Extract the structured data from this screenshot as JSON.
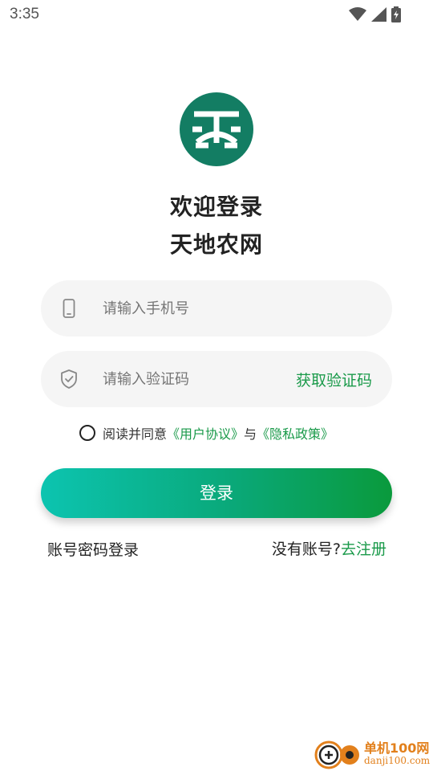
{
  "status_bar": {
    "time": "3:35",
    "icons": [
      "wifi-icon",
      "signal-icon",
      "battery-charging-icon"
    ]
  },
  "logo": {
    "name": "tiandinongwang-logo",
    "color": "#137d63"
  },
  "welcome": {
    "line1": "欢迎登录",
    "line2": "天地农网"
  },
  "phone_field": {
    "icon": "phone-icon",
    "placeholder": "请输入手机号"
  },
  "code_field": {
    "icon": "shield-check-icon",
    "placeholder": "请输入验证码",
    "get_code_label": "获取验证码"
  },
  "agreement": {
    "prefix": "阅读并同意",
    "user_agreement": "《用户协议》",
    "conjunction": "与",
    "privacy_policy": "《隐私政策》",
    "checked": false
  },
  "login_button": {
    "label": "登录"
  },
  "footer": {
    "password_login": "账号密码登录",
    "no_account": "没有账号?",
    "register": "去注册"
  },
  "watermark": {
    "title": "单机100网",
    "url": "danji100.com"
  },
  "colors": {
    "accent_green": "#1a9a4a",
    "button_gradient_start": "#0cc4b0",
    "button_gradient_end": "#0a9a3c",
    "field_bg": "#f5f5f5"
  }
}
